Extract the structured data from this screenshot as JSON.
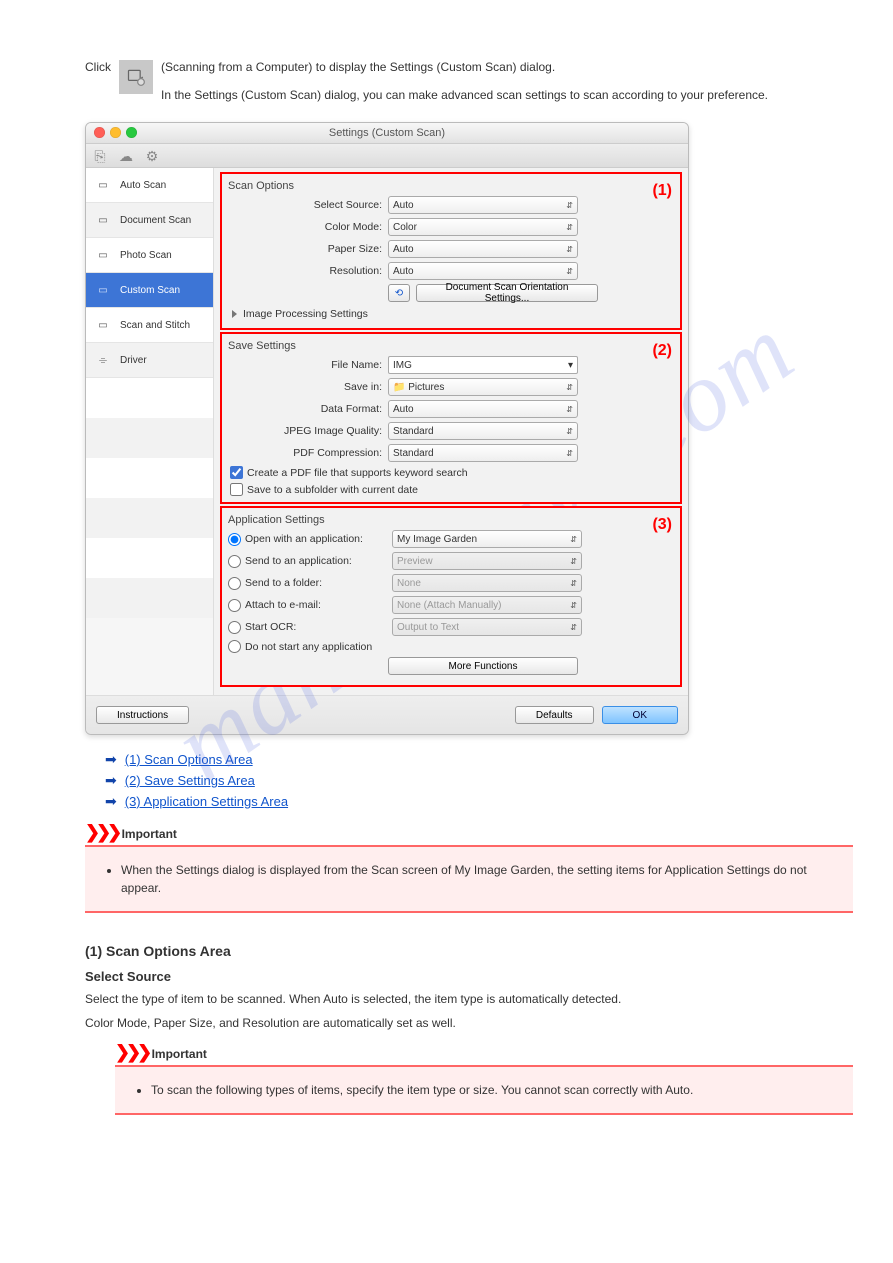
{
  "watermark": "manualshive.com",
  "intro_before": "Click",
  "intro_after": " (Scanning from a Computer) to display the Settings (Custom Scan) dialog.",
  "intro_line2": "In the Settings (Custom Scan) dialog, you can make advanced scan settings to scan according to your preference.",
  "dialog": {
    "title": "Settings (Custom Scan)",
    "tabs": [
      {
        "name": "Auto Scan"
      },
      {
        "name": "Document Scan"
      },
      {
        "name": "Photo Scan"
      },
      {
        "name": "Custom Scan"
      },
      {
        "name": "Scan and Stitch"
      },
      {
        "name": "Driver"
      }
    ],
    "annotations": [
      "(1)",
      "(2)",
      "(3)"
    ],
    "scan_options": {
      "header": "Scan Options",
      "select_source": {
        "label": "Select Source:",
        "value": "Auto"
      },
      "color_mode": {
        "label": "Color Mode:",
        "value": "Color"
      },
      "paper_size": {
        "label": "Paper Size:",
        "value": "Auto"
      },
      "resolution": {
        "label": "Resolution:",
        "value": "Auto"
      },
      "orientation_btn": "Document Scan Orientation Settings...",
      "expand": "Image Processing Settings"
    },
    "save_settings": {
      "header": "Save Settings",
      "file_name": {
        "label": "File Name:",
        "value": "IMG"
      },
      "save_in": {
        "label": "Save in:",
        "value": "Pictures"
      },
      "data_format": {
        "label": "Data Format:",
        "value": "Auto"
      },
      "jpeg": {
        "label": "JPEG Image Quality:",
        "value": "Standard"
      },
      "pdf_comp": {
        "label": "PDF Compression:",
        "value": "Standard"
      },
      "cb1": "Create a PDF file that supports keyword search",
      "cb2": "Save to a subfolder with current date"
    },
    "app_settings": {
      "header": "Application Settings",
      "open_app": {
        "label": "Open with an application:",
        "value": "My Image Garden"
      },
      "send_app": {
        "label": "Send to an application:",
        "value": "Preview"
      },
      "send_folder": {
        "label": "Send to a folder:",
        "value": "None"
      },
      "email": {
        "label": "Attach to e-mail:",
        "value": "None (Attach Manually)"
      },
      "ocr": {
        "label": "Start OCR:",
        "value": "Output to Text"
      },
      "nostart": "Do not start any application",
      "more": "More Functions"
    },
    "buttons": {
      "instructions": "Instructions",
      "defaults": "Defaults",
      "ok": "OK"
    }
  },
  "links": [
    "(1) Scan Options Area",
    "(2) Save Settings Area",
    "(3) Application Settings Area"
  ],
  "important_label": "Important",
  "important_text": "When the Settings dialog is displayed from the Scan screen of My Image Garden, the setting items for Application Settings do not appear.",
  "section1_h": "(1) Scan Options Area",
  "select_source_h": "Select Source",
  "select_source_body": "Select the type of item to be scanned. When Auto is selected, the item type is automatically detected.",
  "sub_important": "To scan the following types of items, specify the item type or size. You cannot scan correctly with Auto."
}
